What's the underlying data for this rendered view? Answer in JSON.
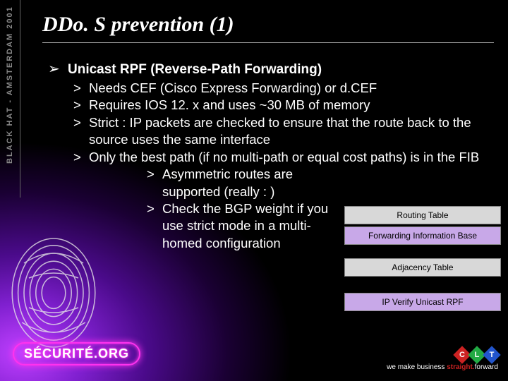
{
  "sidebar": {
    "text": "BLACK HAT - AMSTERDAM 2001"
  },
  "title": "DDo. S prevention (1)",
  "heading": "Unicast RPF (Reverse-Path Forwarding)",
  "subs": [
    "Needs CEF (Cisco Express Forwarding) or d.CEF",
    "Requires IOS 12. x and uses ~30 MB of memory",
    "Strict : IP packets are checked to ensure that the route back to the source uses the same interface",
    "Only the best path (if no multi-path or equal cost paths) is in the FIB"
  ],
  "subs3": [
    "Asymmetric routes are supported (really : )",
    "Check the BGP weight if you use strict mode in a multi-homed configuration"
  ],
  "diagram": {
    "routing_table": "Routing Table",
    "fib": "Forwarding Information Base",
    "adjacency": "Adjacency Table",
    "rpf": "IP Verify Unicast RPF"
  },
  "brand": {
    "securite": "SÉCURITÉ.ORG"
  },
  "footer": {
    "c": "C",
    "l": "L",
    "t": "T",
    "tagline_pre": "we make business ",
    "tagline_sf": "straight.",
    "tagline_post": "forward"
  }
}
